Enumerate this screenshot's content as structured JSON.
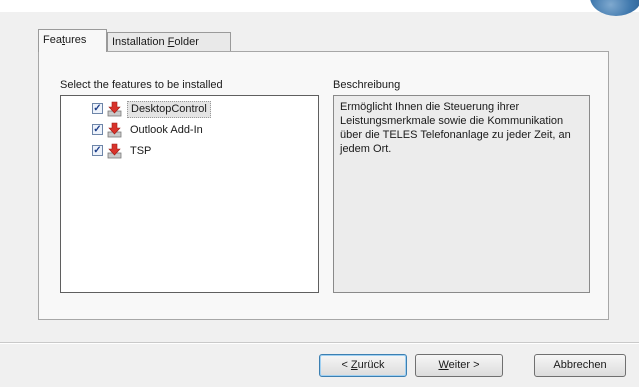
{
  "tabs": [
    {
      "label_pre": "Fea",
      "label_key": "t",
      "label_post": "ures",
      "active": true
    },
    {
      "label_pre": "Installation ",
      "label_key": "F",
      "label_post": "older",
      "active": false
    }
  ],
  "features": {
    "caption": "Select the features to be installed",
    "items": [
      {
        "label": "DesktopControl",
        "checked": true,
        "selected": true
      },
      {
        "label": "Outlook Add-In",
        "checked": true,
        "selected": false
      },
      {
        "label": "TSP",
        "checked": true,
        "selected": false
      }
    ]
  },
  "description": {
    "caption": "Beschreibung",
    "text": "Ermöglicht Ihnen die Steuerung ihrer Leistungsmerkmale sowie die Kommunikation über die TELES Telefonanlage zu jeder Zeit, an jedem Ort."
  },
  "buttons": {
    "back": {
      "pre": "< ",
      "key": "Z",
      "post": "urück"
    },
    "next": {
      "pre": "",
      "key": "W",
      "post": "eiter >"
    },
    "cancel": {
      "label": "Abbrechen"
    }
  },
  "colors": {
    "accent": "#3c7fb1",
    "feature_icon": "#d8332b"
  },
  "icons": {
    "checkbox": "checkbox-checked-icon",
    "feature": "install-feature-icon"
  }
}
